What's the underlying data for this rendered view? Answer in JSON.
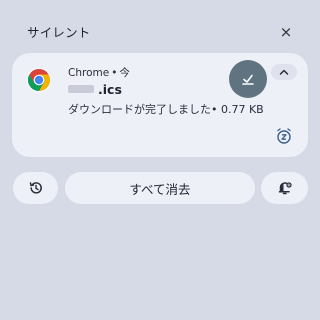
{
  "section": {
    "title": "サイレント",
    "close_glyph": "×"
  },
  "notification": {
    "app_icon": "chrome-icon",
    "app_name": "Chrome",
    "separator": "•",
    "time": "今",
    "filename": ".ics",
    "message": "ダウンロードが完了しました• 0.77 KB",
    "action_icon": "file-open-icon",
    "expand_icon": "chevron-up-icon",
    "snooze_icon": "snooze-icon"
  },
  "footer": {
    "history_icon": "history-icon",
    "clear_all_label": "すべて消去",
    "settings_icon": "notification-settings-icon"
  },
  "colors": {
    "background": "#d6d9e6",
    "card": "#eef0f8",
    "action_circle": "#5f7480",
    "chrome_red": "#db4437",
    "chrome_green": "#0f9d58",
    "chrome_yellow": "#f4b400",
    "chrome_blue": "#4285f4"
  }
}
